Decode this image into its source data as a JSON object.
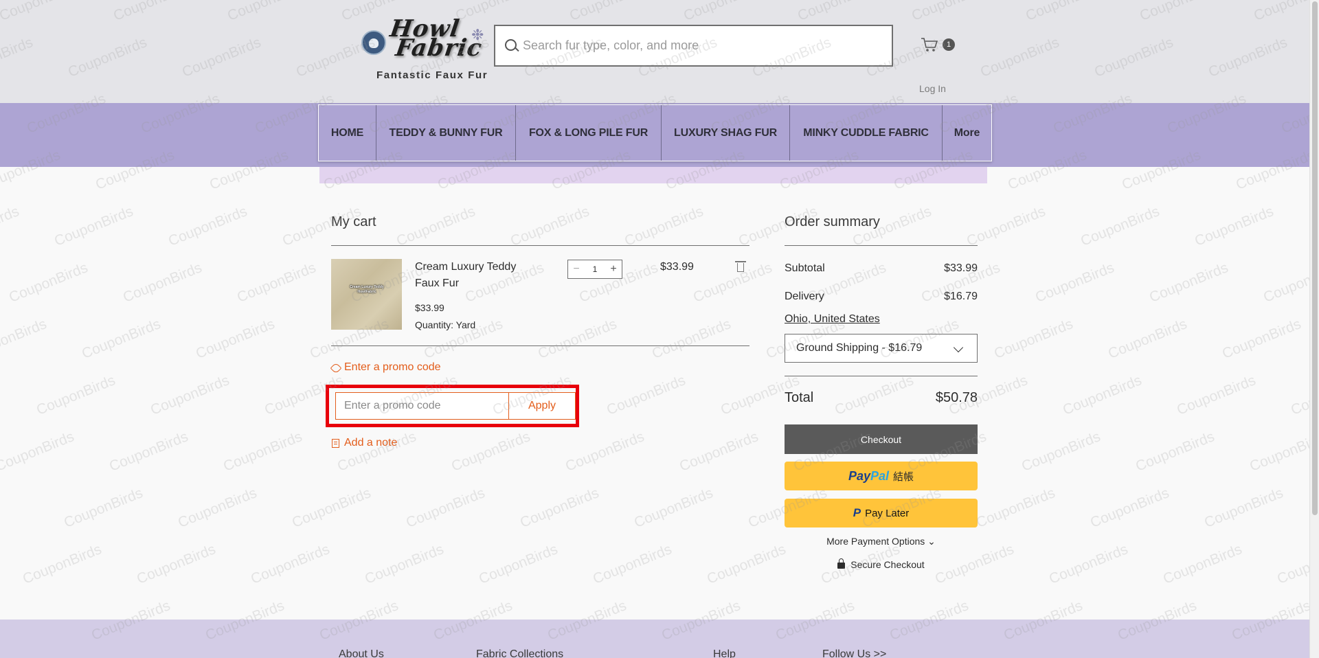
{
  "brand": {
    "logo_line1": "Howl",
    "logo_line2": "Fabric",
    "tagline": "Fantastic Faux Fur"
  },
  "search": {
    "placeholder": "Search fur type, color, and more"
  },
  "header": {
    "cart_count": "1",
    "login_label": "Log In"
  },
  "nav": {
    "items": [
      {
        "label": "HOME"
      },
      {
        "label": "TEDDY & BUNNY FUR"
      },
      {
        "label": "FOX & LONG PILE FUR"
      },
      {
        "label": "LUXURY SHAG FUR"
      },
      {
        "label": "MINKY CUDDLE FABRIC"
      },
      {
        "label": "More"
      }
    ]
  },
  "cart": {
    "title": "My cart",
    "item": {
      "thumb_label": "Cream Luxury Teddy HowlFabric",
      "name": "Cream Luxury Teddy Faux Fur",
      "unit_price": "$33.99",
      "quantity_type": "Quantity: Yard",
      "quantity": "1",
      "minus": "−",
      "plus": "+",
      "total": "$33.99"
    },
    "promo_link": "Enter a promo code",
    "promo_placeholder": "Enter a promo code",
    "apply_label": "Apply",
    "note_link": "Add a note"
  },
  "summary": {
    "title": "Order summary",
    "subtotal_label": "Subtotal",
    "subtotal_value": "$33.99",
    "delivery_label": "Delivery",
    "delivery_value": "$16.79",
    "location": "Ohio, United States",
    "shipping_option": "Ground Shipping - $16.79",
    "total_label": "Total",
    "total_value": "$50.78",
    "checkout_label": "Checkout",
    "paypal_pay": "Pay",
    "paypal_pal": "Pal",
    "paypal_suffix": "結帳",
    "paylater_label": "Pay Later",
    "paylater_logo": "P",
    "more_payment": "More Payment Options ⌄",
    "secure_checkout": "Secure Checkout"
  },
  "footer": {
    "links": [
      {
        "label": "About Us"
      },
      {
        "label": "Fabric Collections"
      },
      {
        "label": "Help"
      },
      {
        "label": "Follow Us >>"
      }
    ]
  },
  "watermark": "CouponBirds",
  "colors": {
    "accent": "#e35d1b",
    "nav_bg": "#ada4d3",
    "highlight": "#e8000b",
    "paypal": "#ffc43a"
  }
}
